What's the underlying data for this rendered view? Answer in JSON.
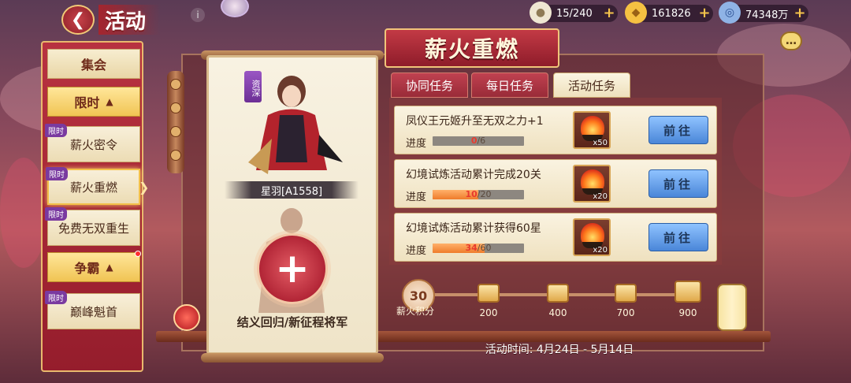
{
  "top": {
    "title": "活动",
    "resources": [
      {
        "icon": "bun-icon",
        "value": "15/240"
      },
      {
        "icon": "gold-ingot-icon",
        "value": "161826"
      },
      {
        "icon": "silver-coin-icon",
        "value": "74348万"
      }
    ]
  },
  "sidebar": {
    "items": [
      {
        "label": "集会",
        "type": "plain"
      },
      {
        "label": "限时",
        "type": "group",
        "caret": "▲"
      },
      {
        "label": "薪火密令",
        "type": "item",
        "tag": "限时"
      },
      {
        "label": "薪火重燃",
        "type": "item",
        "tag": "限时",
        "active": true
      },
      {
        "label": "免费无双重生",
        "type": "item",
        "tag": "限时"
      },
      {
        "label": "争霸",
        "type": "group",
        "caret": "▲"
      },
      {
        "label": "巅峰魁首",
        "type": "item",
        "tag": "限时"
      }
    ]
  },
  "panel": {
    "title": "薪火重燃",
    "character_tag": "资深",
    "character_name": "星羽[A1558]",
    "recruit_text": "结义回归/新征程将军"
  },
  "tabs": [
    {
      "label": "协同任务",
      "active": false
    },
    {
      "label": "每日任务",
      "active": false
    },
    {
      "label": "活动任务",
      "active": true
    }
  ],
  "tasks": [
    {
      "title": "凤仪王元姬升至无双之力+1",
      "progress_label": "进度",
      "current": "0",
      "total": "/6",
      "fraction": 0.0,
      "reward_qty": "x50",
      "button": "前往"
    },
    {
      "title": "幻境试炼活动累计完成20关",
      "progress_label": "进度",
      "current": "10",
      "total": "/20",
      "fraction": 0.5,
      "reward_qty": "x20",
      "button": "前往"
    },
    {
      "title": "幻境试炼活动累计获得60星",
      "progress_label": "进度",
      "current": "34",
      "total": "/60",
      "fraction": 0.567,
      "reward_qty": "x20",
      "button": "前往"
    }
  ],
  "points": {
    "score": "30",
    "label": "薪火积分",
    "milestones": [
      "200",
      "400",
      "700",
      "900"
    ]
  },
  "time_text": "活动时间: 4月24日 - 5月14日",
  "colors": {
    "accent_red": "#b83240",
    "gold": "#f0c453",
    "button_blue": "#4a86d8",
    "progress_orange": "#ef7c2b"
  }
}
